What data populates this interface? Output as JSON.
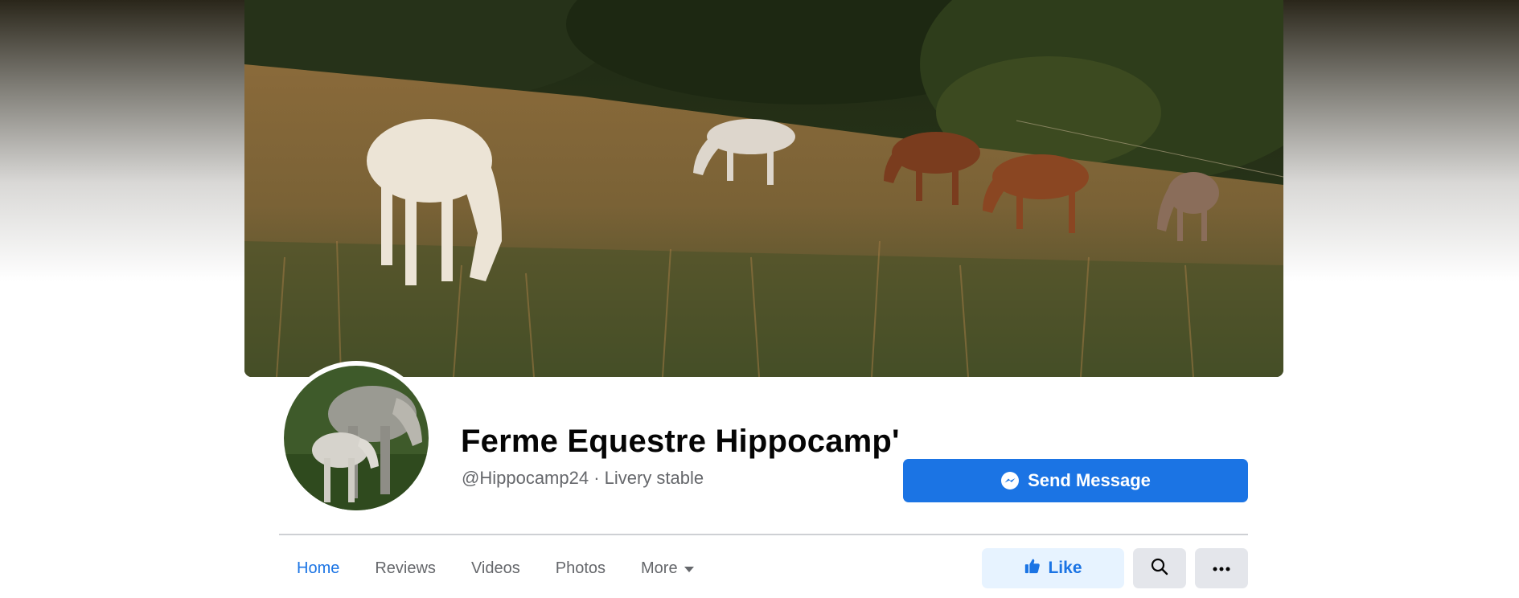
{
  "page": {
    "name": "Ferme Equestre Hippocamp'",
    "subtitle": "@Hippocamp24 · Livery stable",
    "cover_image": "horses-grazing-in-meadow",
    "profile_image": "mare-and-foal"
  },
  "actions": {
    "send_message_label": "Send Message",
    "like_label": "Like",
    "search_icon": "search-icon",
    "more_icon": "more-options-icon"
  },
  "tabs": [
    {
      "label": "Home",
      "active": true
    },
    {
      "label": "Reviews",
      "active": false
    },
    {
      "label": "Videos",
      "active": false
    },
    {
      "label": "Photos",
      "active": false
    },
    {
      "label": "More",
      "active": false,
      "dropdown": true
    }
  ],
  "colors": {
    "accent": "#1b74e4",
    "like_bg": "#e7f3ff",
    "secondary_button": "#e4e6eb",
    "muted_text": "#65676b"
  }
}
